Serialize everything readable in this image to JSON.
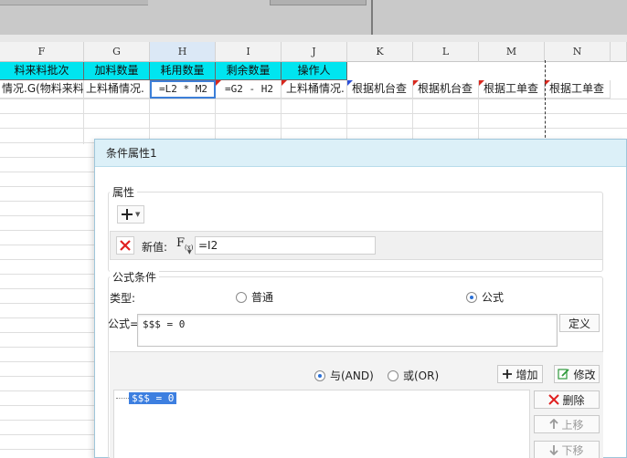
{
  "columns": [
    {
      "letter": "F"
    },
    {
      "letter": "G"
    },
    {
      "letter": "H"
    },
    {
      "letter": "I"
    },
    {
      "letter": "J"
    },
    {
      "letter": "K"
    },
    {
      "letter": "L"
    },
    {
      "letter": "M"
    },
    {
      "letter": "N"
    }
  ],
  "header_row": {
    "F": "料来料批次",
    "G": "加料数量",
    "H": "耗用数量",
    "I": "剩余数量",
    "J": "操作人"
  },
  "data_row": {
    "F": "情况.G(物料来料",
    "G": "上料桶情况.",
    "H": "=L2 * M2",
    "I": "=G2 - H2",
    "J": "上料桶情况.",
    "K": "根据机台查",
    "L": "根据机台查",
    "M": "根据工单查",
    "N": "根据工单查"
  },
  "dialog": {
    "title": "条件属性1",
    "attr_group_label": "属性",
    "new_value_label": "新值:",
    "fx_label": "F",
    "fx_sub": "(x)",
    "new_value": "=I2",
    "formula_group_label": "公式条件",
    "type_label": "类型:",
    "radio_normal": "普通",
    "radio_formula": "公式",
    "formula_label": "公式=",
    "formula_text": "$$$ = 0",
    "define_button": "定义",
    "and_label": "与(AND)",
    "or_label": "或(OR)",
    "add_button": "增加",
    "modify_button": "修改",
    "delete_button": "删除",
    "up_button": "上移",
    "down_button": "下移",
    "condition_item": "$$$ = 0"
  },
  "colors": {
    "header_fill": "#00e5f0",
    "dialog_title_bg": "#dcf0f8",
    "selection": "#3d7fe0"
  }
}
